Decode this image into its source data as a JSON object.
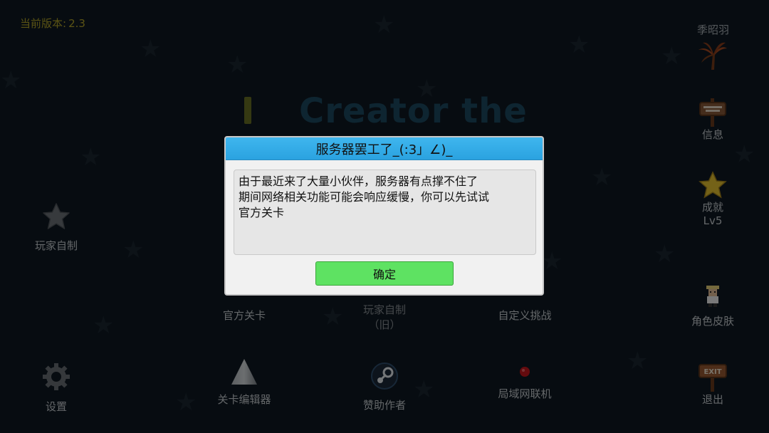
{
  "version": {
    "label": "当前版本:",
    "value": "2.3"
  },
  "user": {
    "name": "季昭羽"
  },
  "title": {
    "text": "Creator   the"
  },
  "right_menu": {
    "info": "信息",
    "achievement": "成就",
    "achievement_level": "Lv5",
    "skin": "角色皮肤",
    "exit": "退出"
  },
  "left_menu": {
    "player_made": "玩家自制",
    "settings": "设置"
  },
  "main_menu": {
    "official_levels": "官方关卡",
    "player_made_old_line1": "玩家自制",
    "player_made_old_line2": "（旧）",
    "custom_challenge": "自定义挑战",
    "level_editor": "关卡编辑器",
    "sponsor": "赞助作者",
    "lan": "局域网联机"
  },
  "dialog": {
    "title": "服务器罢工了_(:3」∠)_",
    "message_lines": [
      "由于最近来了大量小伙伴，服务器有点撑不住了",
      "期间网络相关功能可能会响应缓慢，你可以先试试",
      "官方关卡"
    ],
    "ok_label": "确定"
  },
  "colors": {
    "dialog_header": "#2aa2e0",
    "ok_button": "#5ee262",
    "version_text": "#b5a629"
  }
}
